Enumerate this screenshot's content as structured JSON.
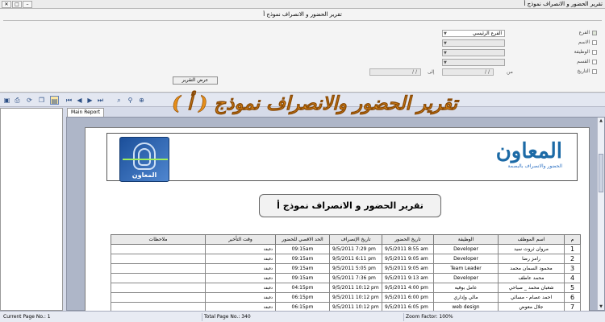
{
  "window": {
    "title": "تقرير الحضور و الانصراف نموذج أ"
  },
  "panel": {
    "title": "تقرير الحضور و الانصراف نموذج أ",
    "filters": [
      {
        "label": "الفرع",
        "checked": true
      },
      {
        "label": "الاسم",
        "checked": false
      },
      {
        "label": "الوظيفة",
        "checked": false
      },
      {
        "label": "القسم",
        "checked": false
      },
      {
        "label": "التاريخ",
        "checked": false
      }
    ],
    "branch_value": "الفرع الرئيسي",
    "date_from_label": "من",
    "date_to_label": "إلى",
    "date_placeholder": "/ /",
    "show_button": "عرض التقرير"
  },
  "overlay_title": "تقرير الحضور والانصراف نموذج ( أ )",
  "tab_label": "Main Report",
  "report": {
    "brand_name": "المعاون",
    "brand_tagline": "الحضور والانصراف بالبصمة",
    "logo_text": "المعاون",
    "title": "تقرير الحضور و الانصراف نموذج أ",
    "columns": [
      "م",
      "اسم الموظف",
      "الوظيفة",
      "تاريخ الحضور",
      "تاريخ الإنصراف",
      "الحد الاقصي للحضور",
      "وقت التأخير",
      "ملاحظات"
    ],
    "rows": [
      {
        "no": "1",
        "name": "مروان ثروت سيد",
        "job": "Developer",
        "in": "9/5/2011   8:55 am",
        "out": "9/5/2011   7:29 pm",
        "max": "09:15am",
        "late": "دقيقة"
      },
      {
        "no": "2",
        "name": "رامز رضا",
        "job": "Developer",
        "in": "9/5/2011   9:05 am",
        "out": "9/5/2011   6:11 pm",
        "max": "09:15am",
        "late": "دقيقة"
      },
      {
        "no": "3",
        "name": "محمود السمان محمد",
        "job": "Team Leader",
        "in": "9/5/2011   9:05 am",
        "out": "9/5/2011   5:05 pm",
        "max": "09:15am",
        "late": "دقيقة"
      },
      {
        "no": "4",
        "name": "محمد عاطف",
        "job": "Developer",
        "in": "9/5/2011   9:13 am",
        "out": "9/5/2011   7:36 pm",
        "max": "09:15am",
        "late": "دقيقة"
      },
      {
        "no": "5",
        "name": "شعبان محمد _ صباحي",
        "job": "عامل بوفيه",
        "in": "9/5/2011   4:00 pm",
        "out": "9/5/2011 10:12 pm",
        "max": "04:15pm",
        "late": "دقيقة"
      },
      {
        "no": "6",
        "name": "احمد عصام - مسائي",
        "job": "مالي وإداري",
        "in": "9/5/2011   6:00 pm",
        "out": "9/5/2011 10:12 pm",
        "max": "06:15pm",
        "late": "دقيقة"
      },
      {
        "no": "7",
        "name": "جلال معوض",
        "job": "web design",
        "in": "9/5/2011   6:05 pm",
        "out": "9/5/2011 10:12 pm",
        "max": "06:15pm",
        "late": "دقيقة"
      }
    ]
  },
  "status": {
    "current_page": "Current Page No.: 1",
    "total_page": "Total Page No.: 340",
    "zoom": "Zoom Factor: 100%"
  }
}
